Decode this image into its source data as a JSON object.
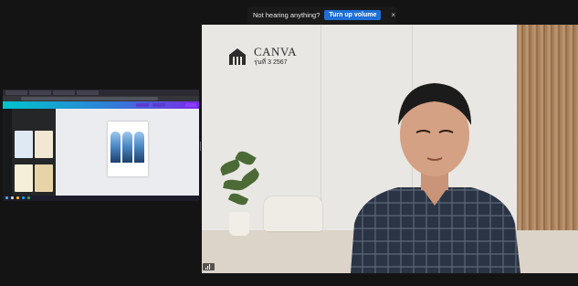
{
  "notice": {
    "message": "Not hearing anything?",
    "action_label": "Turn up volume",
    "close_glyph": "×"
  },
  "speaker_tile": {
    "backdrop_logo": {
      "title": "CANVA",
      "subtitle": "รุ่นที่ 3 2567",
      "icon": "building-logo-icon"
    },
    "participant_name_tag": "",
    "audio_icon": "audio-level-icon"
  },
  "shared_screen": {
    "app": "Canva editor in browser",
    "colors": {
      "toolbar_start": "#00c4cc",
      "toolbar_end": "#7d2ae8"
    }
  },
  "colors": {
    "background": "#141414",
    "notice_button": "#1f6fd6"
  }
}
